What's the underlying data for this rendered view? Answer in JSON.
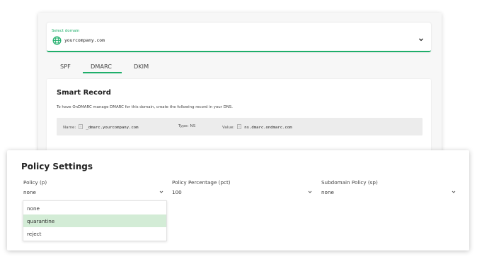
{
  "domain_select": {
    "label": "Select domain",
    "value": "yourcompany.com"
  },
  "tabs": [
    {
      "label": "SPF",
      "active": false
    },
    {
      "label": "DMARC",
      "active": true
    },
    {
      "label": "DKIM",
      "active": false
    }
  ],
  "smart_record": {
    "title": "Smart Record",
    "description": "To have OnDMARC manage DMARC for this domain, create the following record in your DNS.",
    "name_label": "Name:",
    "name_value": "_dmarc.yourcompany.com",
    "type_label": "Type:",
    "type_value": "NS",
    "value_label": "Value:",
    "value_value": "ns.dmarc.ondmarc.com"
  },
  "policy_settings": {
    "title": "Policy Settings",
    "fields": [
      {
        "label": "Policy (p)",
        "value": "none"
      },
      {
        "label": "Policy Percentage (pct)",
        "value": "100"
      },
      {
        "label": "Subdomain Policy (sp)",
        "value": "none"
      }
    ],
    "dropdown_options": [
      {
        "label": "none",
        "highlighted": false
      },
      {
        "label": "quarantine",
        "highlighted": true
      },
      {
        "label": "reject",
        "highlighted": false
      }
    ]
  },
  "colors": {
    "accent": "#1fae6a",
    "highlight": "#d3ecd6",
    "record_bg": "#ececec"
  }
}
